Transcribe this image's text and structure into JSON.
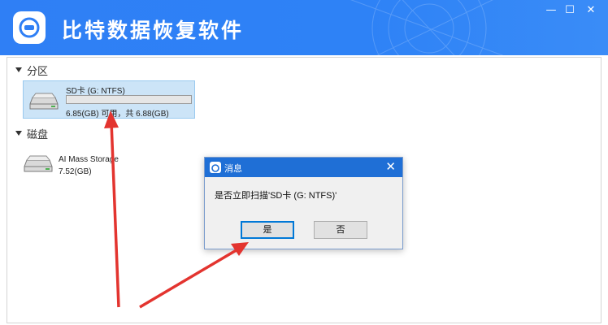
{
  "app": {
    "title": "比特数据恢复软件",
    "brand_color": "#2f7ff5",
    "window_controls": {
      "minimize": "—",
      "maximize": "☐",
      "close": "✕"
    }
  },
  "sections": {
    "partitions": {
      "label": "分区",
      "drives": [
        {
          "name": "SD卡 (G: NTFS)",
          "size_text": "6.85(GB) 可用，共 6.88(GB)",
          "usage_fraction": 0.004,
          "selected": true
        }
      ]
    },
    "disks": {
      "label": "磁盘",
      "drives": [
        {
          "name": "AI Mass Storage",
          "size_text": "7.52(GB)"
        }
      ]
    }
  },
  "dialog": {
    "title": "消息",
    "message": "是否立即扫描'SD卡 (G: NTFS)'",
    "yes_label": "是",
    "no_label": "否",
    "close_icon": "close-icon",
    "title_color": "#1f6fd6"
  },
  "annotation_color": "#e3342f"
}
